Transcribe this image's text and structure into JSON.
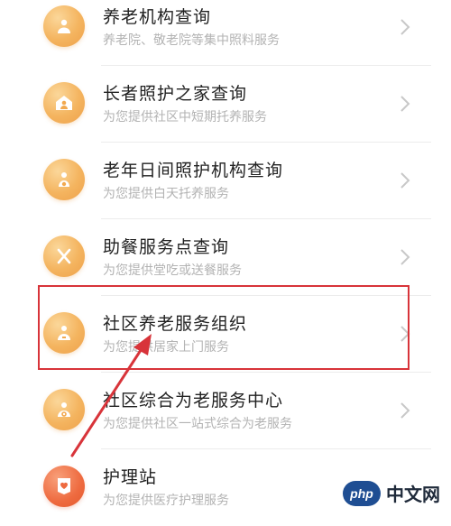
{
  "services": [
    {
      "title": "养老机构查询",
      "subtitle": "养老院、敬老院等集中照料服务",
      "icon": "home-person-icon"
    },
    {
      "title": "长者照护之家查询",
      "subtitle": "为您提供社区中短期托养服务",
      "icon": "house-elder-icon"
    },
    {
      "title": "老年日间照护机构查询",
      "subtitle": "为您提供白天托养服务",
      "icon": "day-care-icon"
    },
    {
      "title": "助餐服务点查询",
      "subtitle": "为您提供堂吃或送餐服务",
      "icon": "meal-icon"
    },
    {
      "title": "社区养老服务组织",
      "subtitle": "为您提供居家上门服务",
      "icon": "community-care-icon"
    },
    {
      "title": "社区综合为老服务中心",
      "subtitle": "为您提供社区一站式综合为老服务",
      "icon": "service-center-icon"
    },
    {
      "title": "护理站",
      "subtitle": "为您提供医疗护理服务",
      "icon": "nursing-heart-icon"
    }
  ],
  "annotation": {
    "highlight_color": "#d8343a"
  },
  "watermark": {
    "badge": "php",
    "text": "中文网"
  },
  "colors": {
    "icon_orange": "#f4b45f",
    "icon_red": "#ee6a3f"
  }
}
